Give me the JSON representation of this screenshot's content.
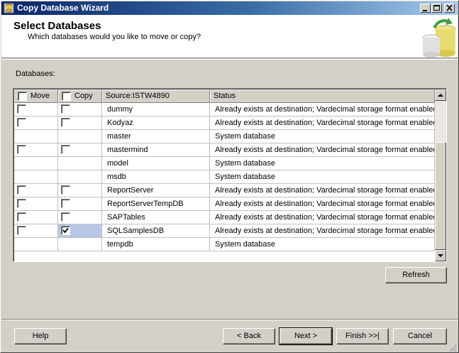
{
  "window": {
    "title": "Copy Database Wizard"
  },
  "header": {
    "title": "Select Databases",
    "subtitle": "Which databases would you like to move or copy?"
  },
  "databases_label": "Databases:",
  "grid": {
    "columns": [
      "Move",
      "Copy",
      "Source:ISTW4890",
      "Status"
    ],
    "rows": [
      {
        "name": "dummy",
        "status": "Already exists at destination; Vardecimal storage format enabled",
        "move": false,
        "copy": false,
        "has_checkboxes": true
      },
      {
        "name": "Kodyaz",
        "status": "Already exists at destination; Vardecimal storage format enabled",
        "move": false,
        "copy": false,
        "has_checkboxes": true
      },
      {
        "name": "master",
        "status": "System database",
        "move": false,
        "copy": false,
        "has_checkboxes": false
      },
      {
        "name": "mastermind",
        "status": "Already exists at destination; Vardecimal storage format enabled",
        "move": false,
        "copy": false,
        "has_checkboxes": true
      },
      {
        "name": "model",
        "status": "System database",
        "move": false,
        "copy": false,
        "has_checkboxes": false
      },
      {
        "name": "msdb",
        "status": "System database",
        "move": false,
        "copy": false,
        "has_checkboxes": false
      },
      {
        "name": "ReportServer",
        "status": "Already exists at destination; Vardecimal storage format enabled",
        "move": false,
        "copy": false,
        "has_checkboxes": true
      },
      {
        "name": "ReportServerTempDB",
        "status": "Already exists at destination; Vardecimal storage format enabled",
        "move": false,
        "copy": false,
        "has_checkboxes": true
      },
      {
        "name": "SAPTables",
        "status": "Already exists at destination; Vardecimal storage format enabled",
        "move": false,
        "copy": false,
        "has_checkboxes": true
      },
      {
        "name": "SQLSamplesDB",
        "status": "Already exists at destination; Vardecimal storage format enabled",
        "move": false,
        "copy": true,
        "has_checkboxes": true,
        "selected": true
      },
      {
        "name": "tempdb",
        "status": "System database",
        "move": false,
        "copy": false,
        "has_checkboxes": false
      }
    ]
  },
  "buttons": {
    "refresh": "Refresh",
    "help": "Help",
    "back": "< Back",
    "next": "Next >",
    "finish": "Finish >>|",
    "cancel": "Cancel"
  },
  "colors": {
    "title_gradient_start": "#0a246a",
    "title_gradient_end": "#a6caf0",
    "selected_cell": "#b8c7e6"
  }
}
